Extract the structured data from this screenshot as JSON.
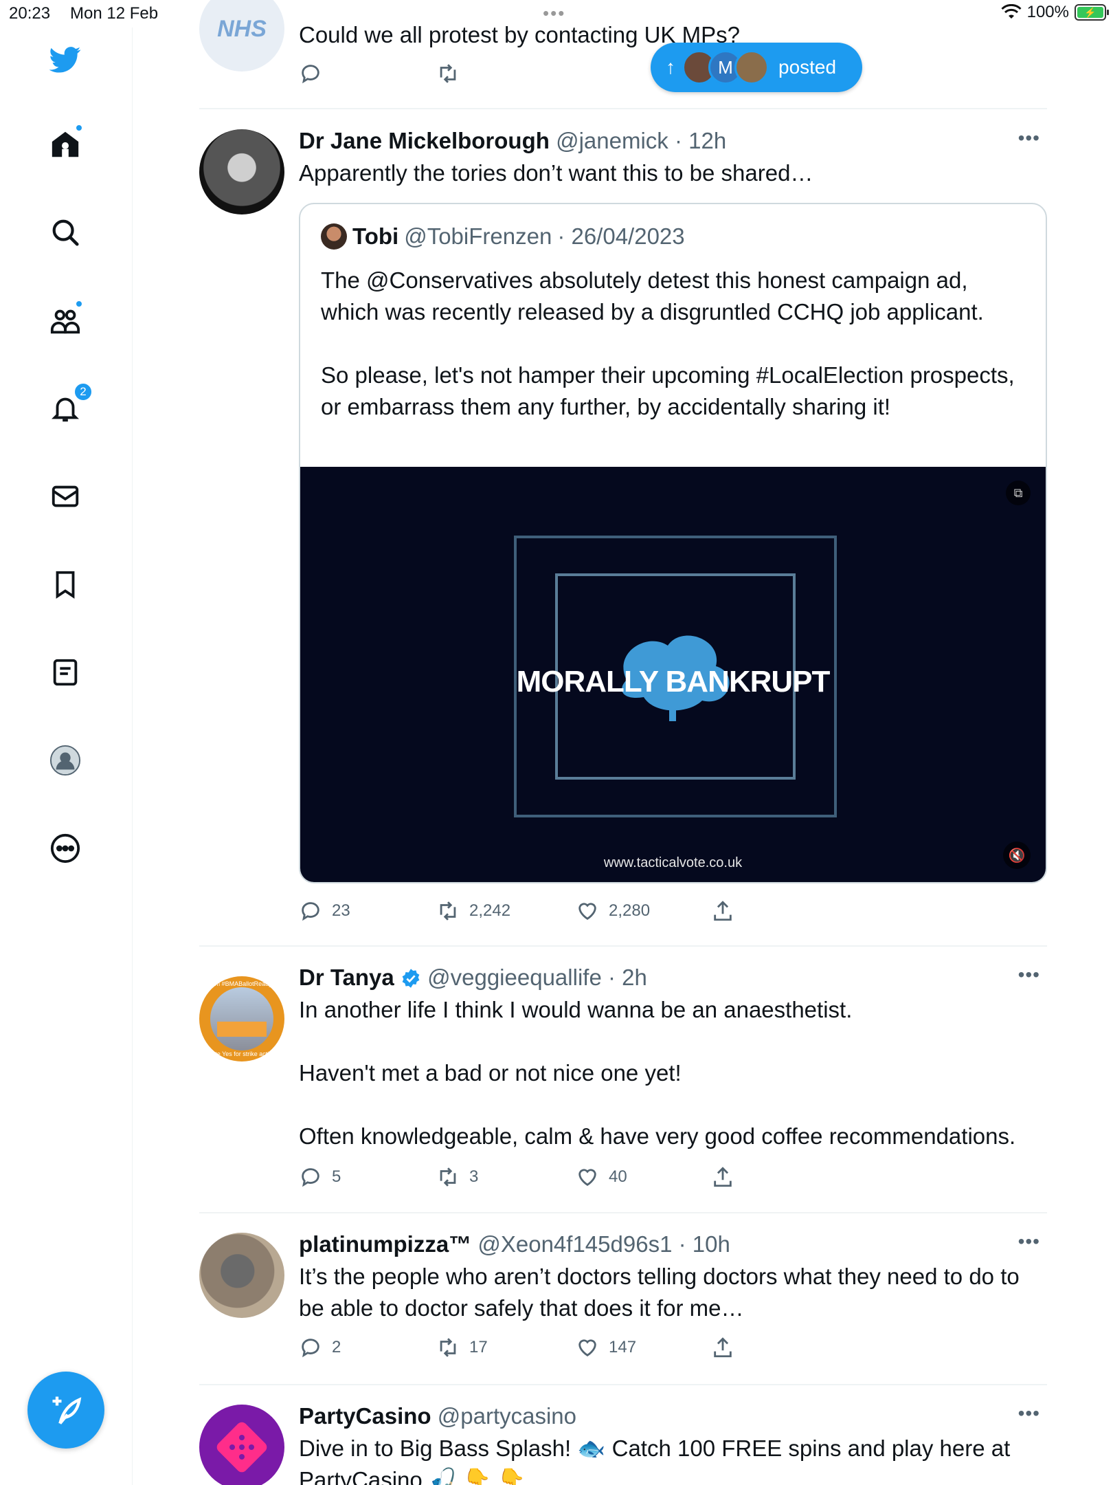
{
  "status_bar": {
    "time": "20:23",
    "date": "Mon 12 Feb",
    "battery": "100%"
  },
  "sidebar": {
    "notifications_badge": "2",
    "items": [
      "twitter-logo",
      "home",
      "explore",
      "communities",
      "notifications",
      "messages",
      "bookmarks",
      "lists",
      "profile",
      "more"
    ]
  },
  "posted_pill": {
    "label": "posted",
    "avatar_letter": "M"
  },
  "tweet0": {
    "avatar_text": "NHS",
    "text": "Could we all protest by contacting UK MPs?"
  },
  "tweet1": {
    "name": "Dr Jane Mickelborough",
    "handle": "@janemick",
    "time": "· 12h",
    "text": "Apparently the tories don’t want this to be shared…",
    "quote": {
      "name": "Tobi",
      "handle": "@TobiFrenzen",
      "time": "· 26/04/2023",
      "text": "The @Conservatives absolutely detest this honest campaign ad, which was recently released by a disgruntled CCHQ job applicant.\n\nSo please, let's not hamper their upcoming #LocalElection prospects, or embarrass them any further, by accidentally sharing it!",
      "video_title": "MORALLY BANKRUPT",
      "video_url": "www.tacticalvote.co.uk"
    },
    "replies": "23",
    "retweets": "2,242",
    "likes": "2,280"
  },
  "tweet2": {
    "name": "Dr Tanya",
    "handle": "@veggieequallife",
    "time": "· 2h",
    "text": "In another life I think I would wanna be an anaesthetist.\n\nHaven't met a bad or not nice one yet!\n\nOften knowledgeable, calm & have very good coffee recommendations.",
    "avatar_ring_top": "I'm #BMABallotReady",
    "avatar_ring_bottom": "Vote Yes for strike action",
    "replies": "5",
    "retweets": "3",
    "likes": "40"
  },
  "tweet3": {
    "name": "platinumpizza™",
    "handle": "@Xeon4f145d96s1",
    "time": "· 10h",
    "text": "It’s the people who aren’t doctors telling doctors what they need to do to be able to doctor safely that does it for me…",
    "replies": "2",
    "retweets": "17",
    "likes": "147"
  },
  "tweet4": {
    "name": "PartyCasino",
    "handle": "@partycasino",
    "text": "Dive in to Big Bass Splash! 🐟 Catch 100 FREE spins and play here at PartyCasino 🎣 👇 👇"
  },
  "colors": {
    "accent": "#1d9bf0",
    "text": "#0f1419",
    "secondary": "#536471",
    "border": "#eff3f4"
  }
}
